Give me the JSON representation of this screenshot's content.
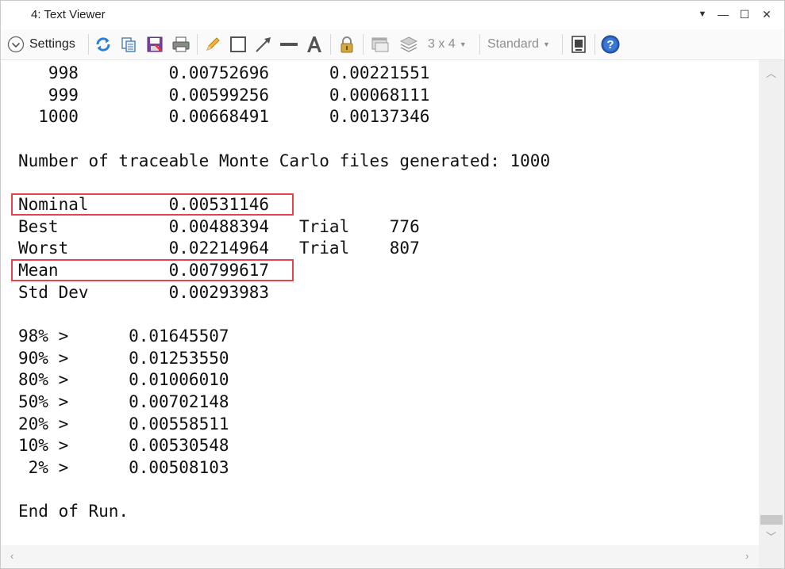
{
  "window": {
    "title": "4: Text Viewer",
    "controls": [
      "▼",
      "—",
      "☐",
      "✕"
    ]
  },
  "toolbar": {
    "settings_label": "Settings",
    "layout_label": "3 x 4",
    "style_label": "Standard",
    "icons": [
      "refresh-icon",
      "copy-icon",
      "save-icon",
      "print-icon",
      "pencil-icon",
      "rectangle-icon",
      "arrow-line-icon",
      "line-icon",
      "text-icon",
      "lock-icon",
      "window-icon",
      "layers-icon",
      "layout-dropdown",
      "style-dropdown",
      "export-icon",
      "help-icon"
    ]
  },
  "text": {
    "rows": [
      "   998         0.00752696      0.00221551",
      "   999         0.00599256      0.00068111",
      "  1000         0.00668491      0.00137346",
      "",
      "Number of traceable Monte Carlo files generated: 1000",
      "",
      "Nominal        0.00531146",
      "Best           0.00488394   Trial    776",
      "Worst          0.02214964   Trial    807",
      "Mean           0.00799617",
      "Std Dev        0.00293983",
      "",
      "98% >      0.01645507",
      "90% >      0.01253550",
      "80% >      0.01006010",
      "50% >      0.00702148",
      "20% >      0.00558511",
      "10% >      0.00530548",
      " 2% >      0.00508103",
      "",
      "End of Run."
    ]
  },
  "colors": {
    "highlight_border": "#e3434d",
    "accent_blue": "#2a6fd6"
  }
}
